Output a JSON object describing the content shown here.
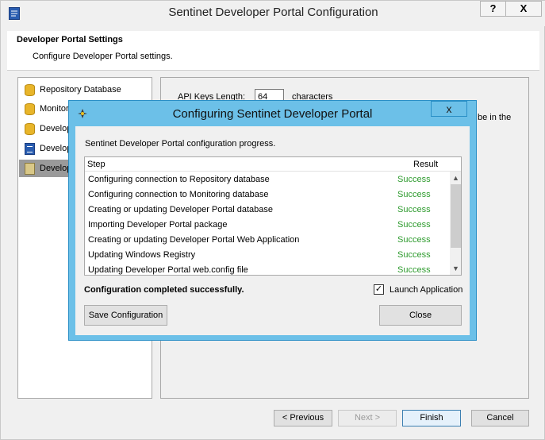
{
  "window": {
    "title": "Sentinet Developer Portal Configuration",
    "help_label": "?",
    "close_label": "X"
  },
  "header": {
    "title": "Developer Portal Settings",
    "subtitle": "Configure Developer Portal settings."
  },
  "sidebar": {
    "items": [
      {
        "label": "Repository Database",
        "icon": "database-icon"
      },
      {
        "label": "Monitorin",
        "icon": "database-icon"
      },
      {
        "label": "Develop",
        "icon": "database-icon"
      },
      {
        "label": "Develop",
        "icon": "document-icon"
      },
      {
        "label": "Develop",
        "icon": "developer-icon",
        "selected": true
      }
    ]
  },
  "content": {
    "api_keys_label": "API Keys Length:",
    "api_keys_value": "64",
    "api_keys_unit": "characters",
    "truncated_text": "be in the"
  },
  "footer": {
    "previous_label": "< Previous",
    "next_label": "Next >",
    "finish_label": "Finish",
    "cancel_label": "Cancel"
  },
  "dialog": {
    "title": "Configuring Sentinet Developer Portal",
    "close_label": "x",
    "description": "Sentinet Developer Portal configuration progress.",
    "columns": {
      "step": "Step",
      "result": "Result"
    },
    "steps": [
      {
        "name": "Configuring connection to Repository database",
        "result": "Success"
      },
      {
        "name": "Configuring connection to Monitoring database",
        "result": "Success"
      },
      {
        "name": "Creating or updating Developer Portal database",
        "result": "Success"
      },
      {
        "name": "Importing Developer Portal package",
        "result": "Success"
      },
      {
        "name": "Creating or updating Developer Portal Web Application",
        "result": "Success"
      },
      {
        "name": "Updating Windows Registry",
        "result": "Success"
      },
      {
        "name": "Updating Developer Portal web.config file",
        "result": "Success"
      }
    ],
    "status": "Configuration completed successfully.",
    "launch_label": "Launch Application",
    "launch_checked": true,
    "save_label": "Save Configuration",
    "close_button_label": "Close"
  },
  "colors": {
    "dialog_frame": "#6cc0e8",
    "success": "#2e9b2e",
    "selected_nav": "#9a9a9a"
  }
}
